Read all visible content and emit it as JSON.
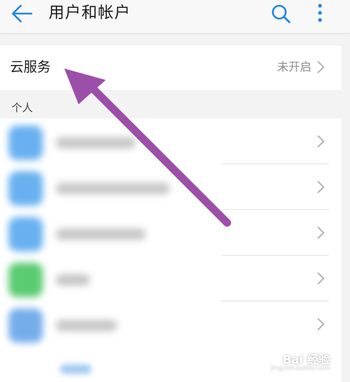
{
  "header": {
    "title": "用户和帐户",
    "back_icon": "arrow-left-icon",
    "search_icon": "search-icon",
    "more_icon": "more-vertical-icon",
    "accent_color": "#1e88e5"
  },
  "cloud": {
    "label": "云服务",
    "status": "未开启",
    "chevron_icon": "chevron-right-icon"
  },
  "section": {
    "header": "个人"
  },
  "accounts": {
    "rows": [
      {
        "icon_color": "#4ea3ee",
        "text_redacted": true
      },
      {
        "icon_color": "#4ea3ee",
        "text_redacted": true
      },
      {
        "icon_color": "#4ea3ee",
        "text_redacted": true
      },
      {
        "icon_color": "#3fc25a",
        "text_redacted": true
      },
      {
        "icon_color": "#5d9fe8",
        "text_redacted": true
      }
    ]
  },
  "annotation": {
    "arrow_color": "#9b4fa8",
    "arrow_icon": "pointer-arrow-annotation"
  },
  "watermark": {
    "logo_text": "Bai 经验",
    "sub_text": "jingyan.baidu.com"
  }
}
